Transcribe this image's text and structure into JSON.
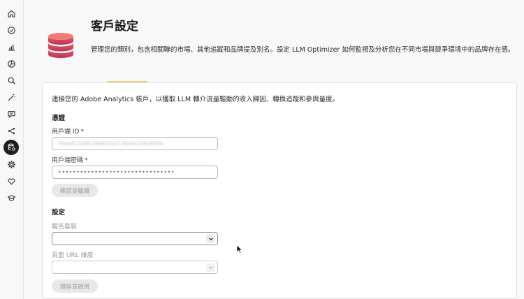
{
  "nav": {
    "items": [
      {
        "icon": "home-icon"
      },
      {
        "icon": "check-circle-icon"
      },
      {
        "icon": "bar-chart-icon"
      },
      {
        "icon": "pie-chart-icon"
      },
      {
        "icon": "search-icon"
      },
      {
        "icon": "magic-wand-icon"
      },
      {
        "icon": "chat-icon"
      },
      {
        "icon": "share-icon"
      },
      {
        "icon": "customer-config-icon",
        "active": true
      },
      {
        "icon": "gear-icon"
      },
      {
        "icon": "heart-icon"
      },
      {
        "icon": "graduation-cap-icon"
      }
    ]
  },
  "header": {
    "title": "客戶設定",
    "description": "管理您的類別，包含相關聯的市場、其他追蹤和品牌提及別名。設定 LLM Optimizer 如何監視及分析您在不同市場與競爭環境中的品牌存在感。"
  },
  "card": {
    "intro": "連接您的 Adobe Analytics 帳戶，以獲取 LLM 轉介流量驅動的收入歸因、轉換追蹤和參與量度。",
    "credentials": {
      "heading": "憑證",
      "client_id_label": "用戶端 ID",
      "client_id_value": "f4ea912a8b34e0d3a7c8e4a1b6d9f0e",
      "client_secret_label": "用戶端密碼",
      "client_secret_value": "••••••••••••••••••••••••••••••••",
      "required_marker": "*",
      "verify_button": "確認並繼續"
    },
    "settings": {
      "heading": "設定",
      "report_suite_label": "報告套裝",
      "report_suite_value": "",
      "page_url_dimension_label": "頁面 URL 維度",
      "page_url_dimension_value": "",
      "save_button": "儲存並啟用"
    }
  },
  "colors": {
    "accent_tab": "#f0c985",
    "active_nav": "#1f1f1f",
    "db_icon_top": "#e85a5a",
    "db_icon_bottom": "#b8325a"
  }
}
